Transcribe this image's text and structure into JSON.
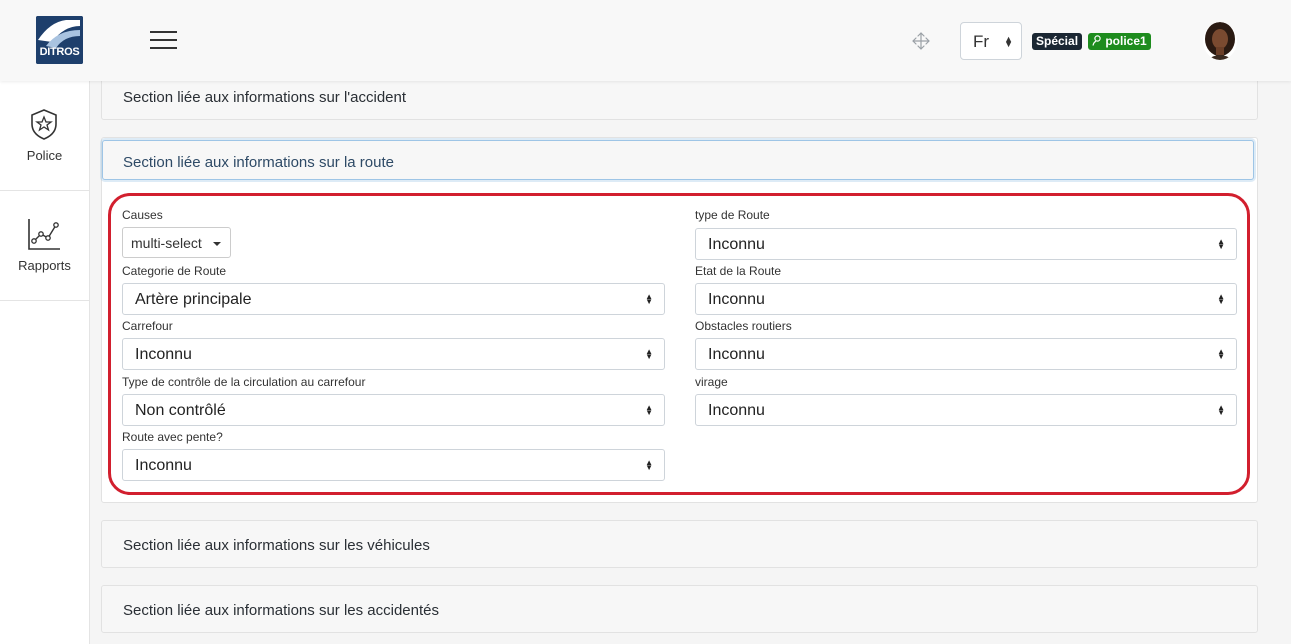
{
  "header": {
    "logo_text": "DITROS",
    "language": "Fr",
    "badge_role": "Spécial",
    "badge_user": "police1",
    "colors": {
      "brand": "#1e3f6c",
      "role_badge": "#1b2733",
      "user_badge": "#1e8c1e",
      "highlight": "#d21f2e"
    }
  },
  "sidebar": {
    "items": [
      {
        "label": "Police",
        "icon": "police-badge-icon"
      },
      {
        "label": "Rapports",
        "icon": "line-chart-icon"
      }
    ]
  },
  "sections": {
    "accident": "Section liée aux informations sur l'accident",
    "route": "Section liée aux informations sur la route",
    "vehicules": "Section liée aux informations sur les véhicules",
    "accidentes": "Section liée aux informations sur les accidentés"
  },
  "route_form": {
    "causes": {
      "label": "Causes",
      "value": "multi-select"
    },
    "type_route": {
      "label": "type de Route",
      "value": "Inconnu"
    },
    "categorie_route": {
      "label": "Categorie de Route",
      "value": "Artère principale"
    },
    "etat_route": {
      "label": "Etat de la Route",
      "value": "Inconnu"
    },
    "carrefour": {
      "label": "Carrefour",
      "value": "Inconnu"
    },
    "obstacles": {
      "label": "Obstacles routiers",
      "value": "Inconnu"
    },
    "controle": {
      "label": "Type de contrôle de la circulation au carrefour",
      "value": "Non contrôlé"
    },
    "virage": {
      "label": "virage",
      "value": "Inconnu"
    },
    "pente": {
      "label": "Route avec pente?",
      "value": "Inconnu"
    }
  }
}
